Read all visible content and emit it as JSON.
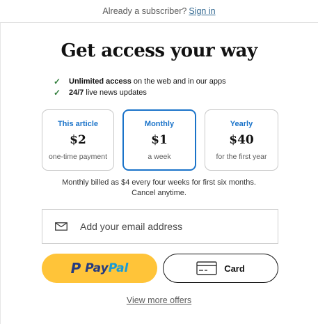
{
  "topbar": {
    "prefix": "Already a subscriber?",
    "signin": "Sign in"
  },
  "headline": "Get access your way",
  "benefits": [
    {
      "bold": "Unlimited access",
      "text": "on the web and in our apps"
    },
    {
      "bold": "24/7",
      "text": "live news updates"
    }
  ],
  "plans": [
    {
      "name": "This article",
      "price": "$2",
      "sub": "one-time payment",
      "selected": false
    },
    {
      "name": "Monthly",
      "price": "$1",
      "sub": "a week",
      "selected": true
    },
    {
      "name": "Yearly",
      "price": "$40",
      "sub": "for the first year",
      "selected": false
    }
  ],
  "note": {
    "line1": "Monthly billed as $4 every four weeks for first six months.",
    "line2": "Cancel anytime."
  },
  "email": {
    "placeholder": "Add your email address",
    "value": ""
  },
  "paypal": {
    "mark": "P",
    "text_a": "Pay",
    "text_b": "Pal"
  },
  "card": {
    "label": "Card"
  },
  "more_offers": "View more offers",
  "colors": {
    "accent": "#1a73c9",
    "paypal_yellow": "#ffc439",
    "check": "#2f7d3a"
  },
  "icons": {
    "check": "check-icon",
    "mail": "mail-icon",
    "card": "credit-card-icon"
  }
}
